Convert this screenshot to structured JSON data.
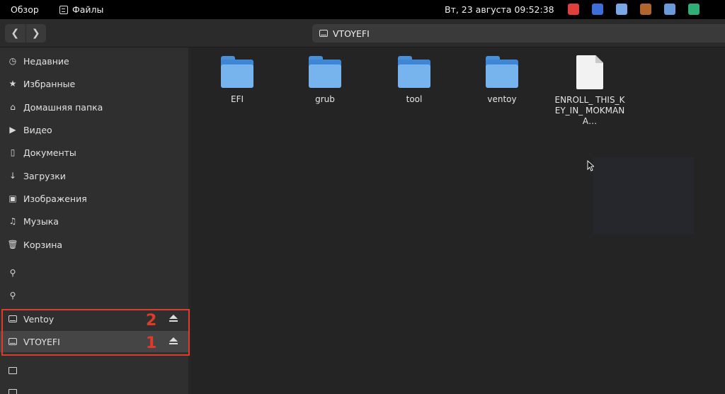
{
  "topbar": {
    "overview": "Обзор",
    "app_name": "Файлы",
    "clock": "Вт, 23 августа  09:52:38",
    "tray_colors": [
      "#e0403a",
      "#3e6fd8",
      "#7aa7e6",
      "#b0652e",
      "#6a9ad8",
      "#2fae78"
    ]
  },
  "headerbar": {
    "back_glyph": "❮",
    "forward_glyph": "❯",
    "path_label": "VTOYEFI"
  },
  "sidebar": {
    "places": [
      {
        "label": "Недавние",
        "icon": "clock-icon",
        "glyph": "◷"
      },
      {
        "label": "Избранные",
        "icon": "star-icon",
        "glyph": "★"
      },
      {
        "label": "Домашняя папка",
        "icon": "home-icon",
        "glyph": "⌂"
      },
      {
        "label": "Видео",
        "icon": "video-icon",
        "glyph": "▶"
      },
      {
        "label": "Документы",
        "icon": "document-icon",
        "glyph": "▯"
      },
      {
        "label": "Загрузки",
        "icon": "download-icon",
        "glyph": "↓"
      },
      {
        "label": "Изображения",
        "icon": "image-icon",
        "glyph": "▣"
      },
      {
        "label": "Музыка",
        "icon": "music-icon",
        "glyph": "♫"
      },
      {
        "label": "Корзина",
        "icon": "trash-icon",
        "glyph": "🗑"
      }
    ],
    "pin_glyph": "⚲",
    "devices": [
      {
        "label": "Ventoy",
        "annotation": "2"
      },
      {
        "label": "VTOYEFI",
        "annotation": "1"
      }
    ]
  },
  "files": [
    {
      "name": "EFI",
      "type": "folder"
    },
    {
      "name": "grub",
      "type": "folder"
    },
    {
      "name": "tool",
      "type": "folder"
    },
    {
      "name": "ventoy",
      "type": "folder"
    },
    {
      "name": "ENROLL_ THIS_KEY_IN_ MOKMANA…",
      "type": "file"
    }
  ]
}
